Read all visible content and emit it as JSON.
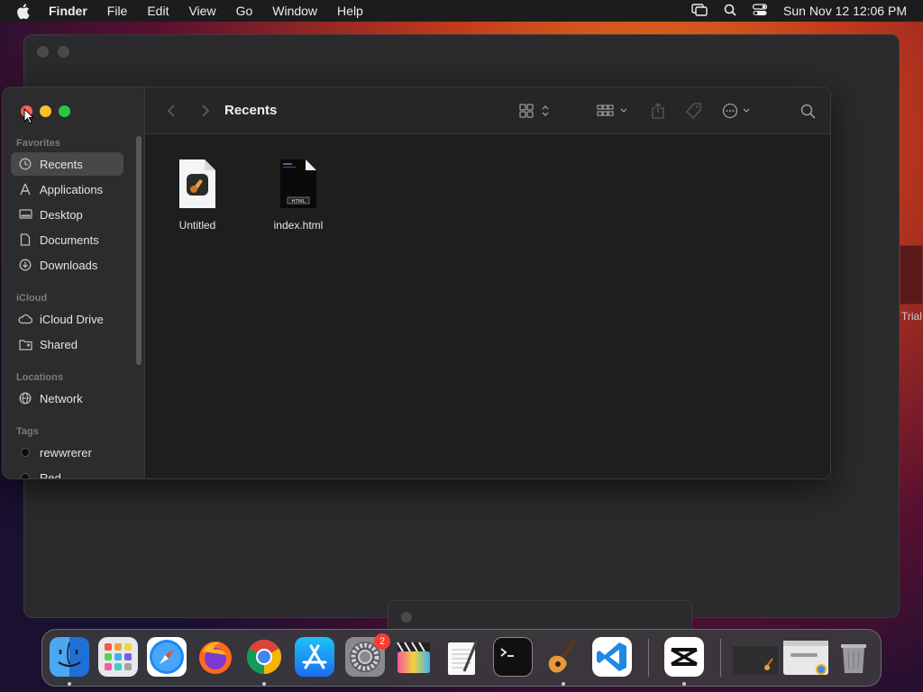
{
  "menubar": {
    "app_name": "Finder",
    "menus": [
      "File",
      "Edit",
      "View",
      "Go",
      "Window",
      "Help"
    ],
    "datetime": "Sun Nov 12  12:06 PM"
  },
  "background": {
    "trial_text": "Trial"
  },
  "finder": {
    "title": "Recents",
    "sidebar": {
      "favorites_label": "Favorites",
      "favorites": [
        {
          "label": "Recents",
          "icon": "clock-icon",
          "active": true
        },
        {
          "label": "Applications",
          "icon": "applications-icon"
        },
        {
          "label": "Desktop",
          "icon": "desktop-icon"
        },
        {
          "label": "Documents",
          "icon": "document-icon"
        },
        {
          "label": "Downloads",
          "icon": "download-icon"
        }
      ],
      "icloud_label": "iCloud",
      "icloud": [
        {
          "label": "iCloud Drive",
          "icon": "cloud-icon"
        },
        {
          "label": "Shared",
          "icon": "shared-folder-icon"
        }
      ],
      "locations_label": "Locations",
      "locations": [
        {
          "label": "Network",
          "icon": "network-icon"
        }
      ],
      "tags_label": "Tags",
      "tags": [
        {
          "label": "rewwrerer",
          "color": "#1a1a1a"
        },
        {
          "label": "Red",
          "color": "#1a1a1a"
        }
      ]
    },
    "files": [
      {
        "name": "Untitled",
        "icon": "garageband-document-icon"
      },
      {
        "name": "index.html",
        "icon": "html-document-icon"
      }
    ]
  },
  "dock": {
    "apps": [
      "Finder",
      "Launchpad",
      "Safari",
      "Firefox",
      "Chrome",
      "App Store",
      "System Settings",
      "Final Cut Pro",
      "TextEdit",
      "Terminal",
      "GarageBand",
      "Visual Studio Code",
      "CapCut"
    ],
    "settings_badge": "2"
  },
  "colors": {
    "accent_red": "#ff5f57",
    "accent_yellow": "#febc2e",
    "accent_green": "#28c840"
  }
}
